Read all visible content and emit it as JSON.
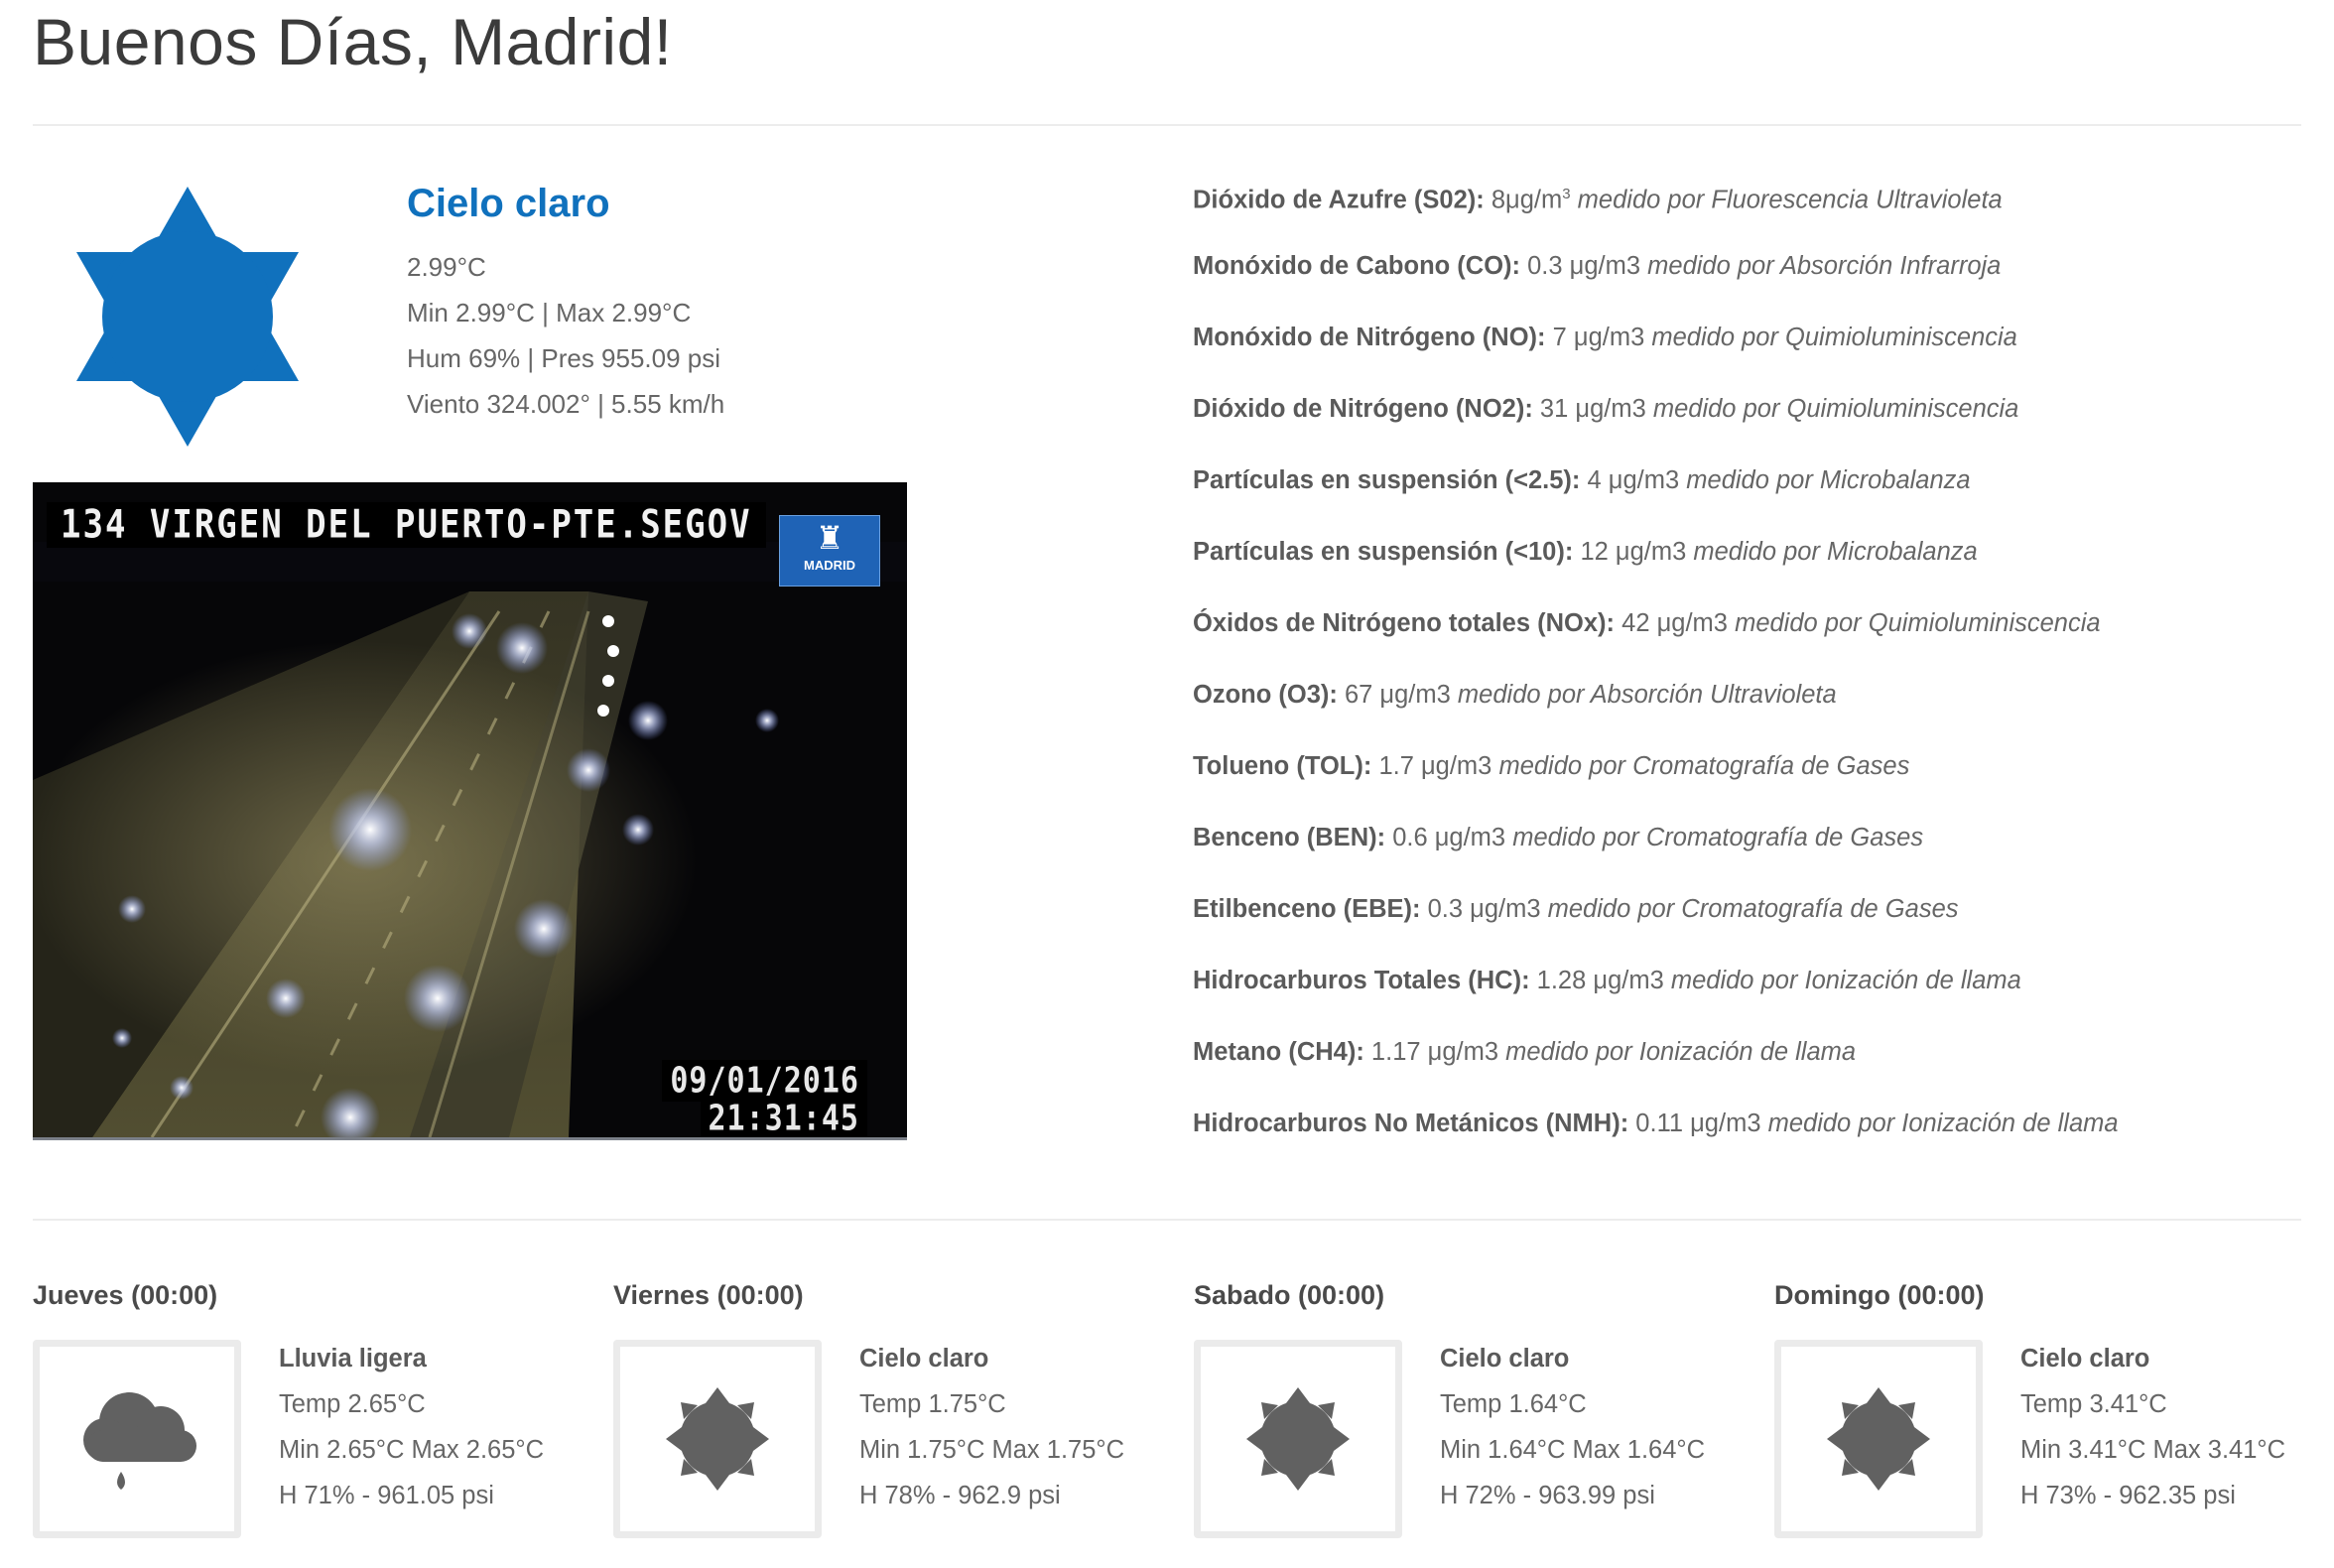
{
  "header": {
    "title": "Buenos Días, Madrid!"
  },
  "current": {
    "condition": "Cielo claro",
    "icon": "sun-star-icon",
    "temp": "2.99°C",
    "minmax": "Min 2.99°C | Max 2.99°C",
    "hum_pres": "Hum 69% | Pres 955.09 psi",
    "wind": "Viento 324.002° | 5.55 km/h",
    "accent_color": "#1071bd"
  },
  "camera": {
    "label": "134 VIRGEN DEL PUERTO-PTE.SEGOV",
    "logo_text": "MADRID",
    "date": "09/01/2016",
    "time": "21:31:45"
  },
  "pollutants": [
    {
      "name": "Dióxido de Azufre (S02):",
      "value": "8μg/m",
      "sup": "3",
      "method": "medido por Fluorescencia Ultravioleta"
    },
    {
      "name": "Monóxido de Cabono (CO):",
      "value": "0.3 μg/m3",
      "method": "medido por Absorción Infrarroja"
    },
    {
      "name": "Monóxido de Nitrógeno (NO):",
      "value": "7 μg/m3",
      "method": "medido por Quimioluminiscencia"
    },
    {
      "name": "Dióxido de Nitrógeno (NO2):",
      "value": "31 μg/m3",
      "method": "medido por Quimioluminiscencia"
    },
    {
      "name": "Partículas en suspensión (<2.5):",
      "value": "4 μg/m3",
      "method": "medido por Microbalanza"
    },
    {
      "name": "Partículas en suspensión (<10):",
      "value": "12 μg/m3",
      "method": "medido por Microbalanza"
    },
    {
      "name": "Óxidos de Nitrógeno totales (NOx):",
      "value": "42 μg/m3",
      "method": "medido por Quimioluminiscencia"
    },
    {
      "name": "Ozono (O3):",
      "value": "67 μg/m3",
      "method": "medido por Absorción Ultravioleta"
    },
    {
      "name": "Tolueno (TOL):",
      "value": "1.7 μg/m3",
      "method": "medido por Cromatografía de Gases"
    },
    {
      "name": "Benceno (BEN):",
      "value": "0.6 μg/m3",
      "method": "medido por Cromatografía de Gases"
    },
    {
      "name": "Etilbenceno (EBE):",
      "value": "0.3 μg/m3",
      "method": "medido por Cromatografía de Gases"
    },
    {
      "name": "Hidrocarburos Totales (HC):",
      "value": "1.28 μg/m3",
      "method": "medido por Ionización de llama"
    },
    {
      "name": "Metano (CH4):",
      "value": "1.17 μg/m3",
      "method": "medido por Ionización de llama"
    },
    {
      "name": "Hidrocarburos No Metánicos (NMH):",
      "value": "0.11 μg/m3",
      "method": "medido por Ionización de llama"
    }
  ],
  "forecast": [
    {
      "day": "Jueves (00:00)",
      "icon": "rain-cloud-icon",
      "condition": "Lluvia ligera",
      "temp": "Temp 2.65°C",
      "minmax": "Min 2.65°C Max 2.65°C",
      "hum_pres": "H 71% - 961.05 psi"
    },
    {
      "day": "Viernes (00:00)",
      "icon": "sun-star-icon",
      "condition": "Cielo claro",
      "temp": "Temp 1.75°C",
      "minmax": "Min 1.75°C Max 1.75°C",
      "hum_pres": "H 78% - 962.9 psi"
    },
    {
      "day": "Sabado (00:00)",
      "icon": "sun-star-icon",
      "condition": "Cielo claro",
      "temp": "Temp 1.64°C",
      "minmax": "Min 1.64°C Max 1.64°C",
      "hum_pres": "H 72% - 963.99 psi"
    },
    {
      "day": "Domingo (00:00)",
      "icon": "sun-star-icon",
      "condition": "Cielo claro",
      "temp": "Temp 3.41°C",
      "minmax": "Min 3.41°C Max 3.41°C",
      "hum_pres": "H 73% - 962.35 psi"
    }
  ],
  "colors": {
    "icon_grey": "#616161",
    "title": "#3b3b3b",
    "text": "#666666"
  }
}
